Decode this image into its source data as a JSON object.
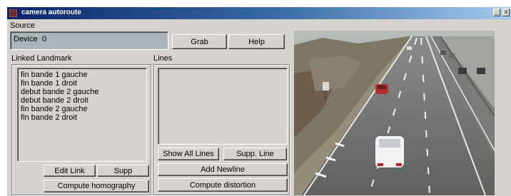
{
  "window": {
    "title": "camera autoroute",
    "minimize_glyph": "_",
    "close_glyph": "x"
  },
  "source": {
    "label": "Source",
    "device_label": "Device",
    "device_value": "0"
  },
  "buttons": {
    "grab": "Grab",
    "help": "Help",
    "edit_link": "Edit Link",
    "supp": "Supp",
    "compute_homography": "Compute homography",
    "show_all_lines": "Show All Lines",
    "supp_line": "Supp. Line",
    "add_newline": "Add Newline",
    "compute_distortion": "Compute distortion"
  },
  "linked_landmark": {
    "label": "Linked Landmark",
    "items": [
      "fin bande 1 gauche",
      "fin bande 1 droit",
      "debut bande 2 gauche",
      "debut bande 2 droit",
      "fin bande 2 gauche",
      "fin bande 2 droit"
    ]
  },
  "lines": {
    "label": "Lines",
    "items": []
  },
  "colors": {
    "window_bg": "#d6d3ce",
    "title_gradient_start": "#0a246a",
    "title_gradient_end": "#a6caf0",
    "device_field_bg": "#a9b5b8",
    "road_asphalt": "#6f7170",
    "car_red": "#b23030",
    "car_white": "#f2f2f2"
  }
}
